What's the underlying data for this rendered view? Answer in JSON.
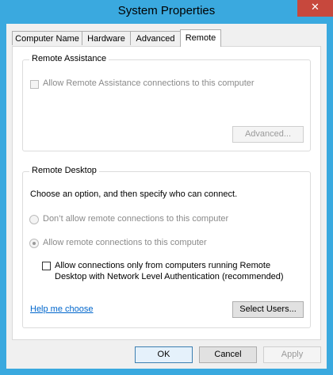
{
  "window": {
    "title": "System Properties",
    "close_label": "✕"
  },
  "tabs": [
    {
      "label": "Computer Name"
    },
    {
      "label": "Hardware"
    },
    {
      "label": "Advanced"
    },
    {
      "label": "Remote"
    }
  ],
  "remote_assistance": {
    "group_label": "Remote Assistance",
    "allow_label": "Allow Remote Assistance connections to this computer",
    "allow_checked": false,
    "advanced_button": "Advanced..."
  },
  "remote_desktop": {
    "group_label": "Remote Desktop",
    "instruction": "Choose an option, and then specify who can connect.",
    "option_dont_allow": "Don’t allow remote connections to this computer",
    "option_allow": "Allow remote connections to this computer",
    "selected_option": "allow",
    "nla_line1": "Allow connections only from computers running Remote",
    "nla_line2": "Desktop with Network Level Authentication (recommended)",
    "nla_checked": false,
    "help_link": "Help me choose",
    "select_users_button": "Select Users..."
  },
  "footer": {
    "ok": "OK",
    "cancel": "Cancel",
    "apply": "Apply"
  }
}
